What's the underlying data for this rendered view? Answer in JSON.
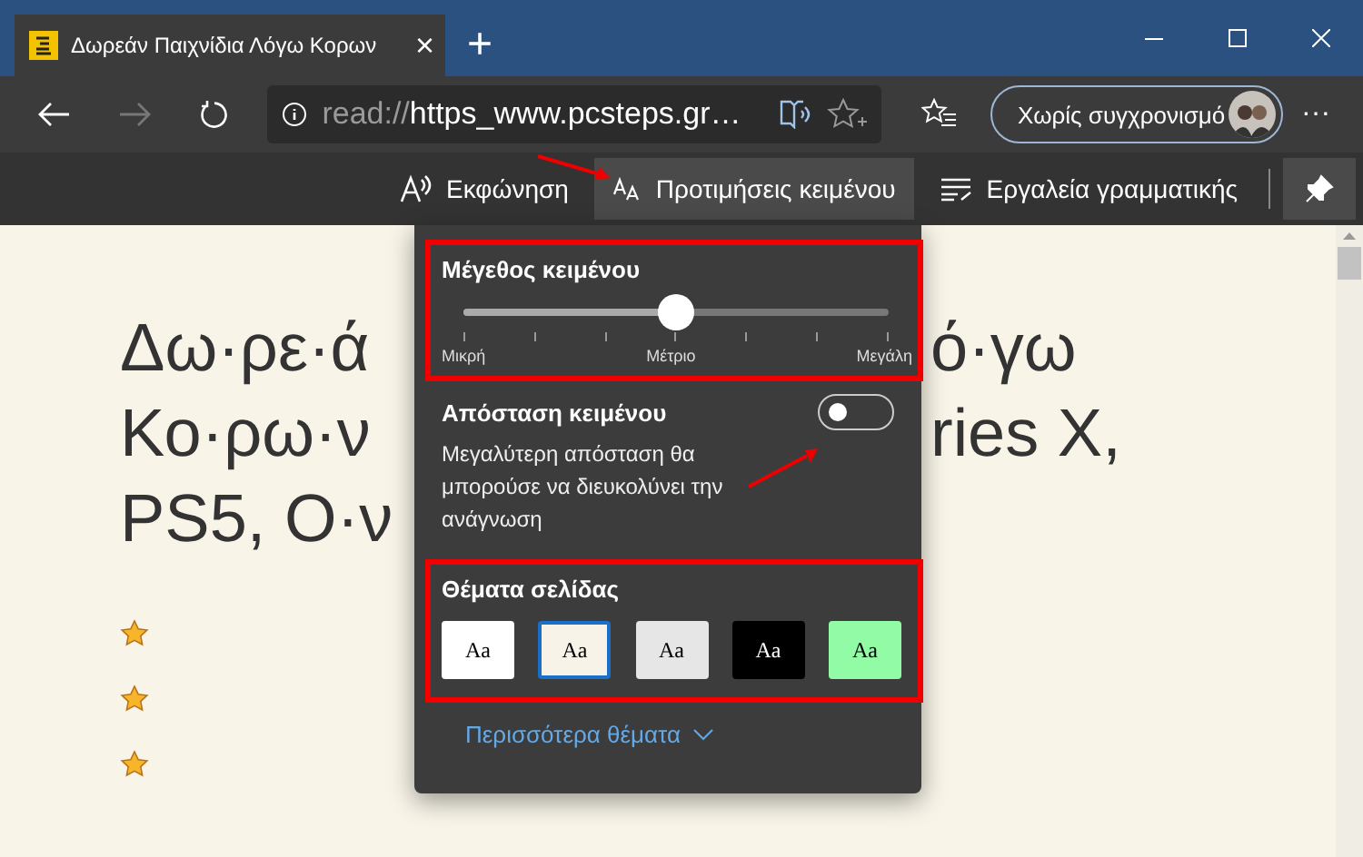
{
  "tab": {
    "title": "Δωρεάν Παιχνίδια Λόγω Κορων",
    "close": "×"
  },
  "new_tab": "+",
  "address": {
    "scheme": "read://",
    "rest": "https_www.pcsteps.gr…"
  },
  "profile": {
    "label": "Χωρίς συγχρονισμό"
  },
  "more": "···",
  "reader_toolbar": [
    {
      "kind": "voice",
      "label": "Εκφώνηση",
      "selected": false
    },
    {
      "kind": "text",
      "label": "Προτιμήσεις κειμένου",
      "selected": true
    },
    {
      "kind": "grammar",
      "label": "Εργαλεία γραμματικής",
      "selected": false
    }
  ],
  "article": {
    "left": [
      "Δω·ρε·ά",
      "Κο·ρω·ν",
      "PS5, Ο·ν"
    ],
    "right": [
      "ό·γω",
      "ries X,"
    ]
  },
  "panel": {
    "size": {
      "title": "Μέγεθος κειμένου",
      "level": 0.5,
      "labels": [
        "Μικρή",
        "Μέτριο",
        "Μεγάλη"
      ]
    },
    "spacing": {
      "title": "Απόσταση κειμένου",
      "on": false,
      "description": "Μεγαλύτερη απόσταση θα μπορούσε να διευκολύνει την ανάγνωση"
    },
    "themes": {
      "title": "Θέματα σελίδας",
      "items": [
        {
          "label": "Aa",
          "color": "#ffffff",
          "selected": false
        },
        {
          "label": "Aa",
          "color": "#f7f3e8",
          "selected": true
        },
        {
          "label": "Aa",
          "color": "#e6e6e6",
          "selected": false
        },
        {
          "label": "Aa",
          "color": "#000000",
          "selected": false
        },
        {
          "label": "Aa",
          "color": "#92fba6",
          "selected": false
        }
      ]
    },
    "more_themes": "Περισσότερα θέματα"
  }
}
